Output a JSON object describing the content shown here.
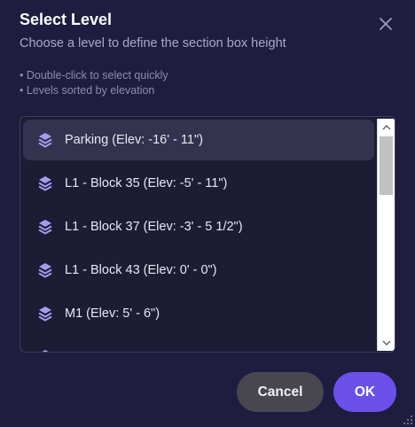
{
  "dialog": {
    "title": "Select Level",
    "subtitle": "Choose a level to define the section box height",
    "hints": [
      "• Double-click to select quickly",
      "• Levels sorted by elevation"
    ]
  },
  "levels": [
    {
      "label": "Parking (Elev: -16' - 11\")",
      "selected": true
    },
    {
      "label": "L1 - Block 35 (Elev: -5' - 11\")",
      "selected": false
    },
    {
      "label": "L1 - Block 37 (Elev: -3' - 5 1/2\")",
      "selected": false
    },
    {
      "label": "L1 - Block 43 (Elev: 0' - 0\")",
      "selected": false
    },
    {
      "label": "M1 (Elev: 5' - 6\")",
      "selected": false
    }
  ],
  "buttons": {
    "cancel": "Cancel",
    "ok": "OK"
  },
  "icons": {
    "close": "close-icon",
    "level": "layers-icon",
    "scroll_up": "chevron-up-icon",
    "scroll_down": "chevron-down-icon",
    "resize": "resize-grip-icon"
  },
  "colors": {
    "background": "#1e1d3f",
    "accent": "#6b50ea",
    "icon": "#a99af0"
  }
}
